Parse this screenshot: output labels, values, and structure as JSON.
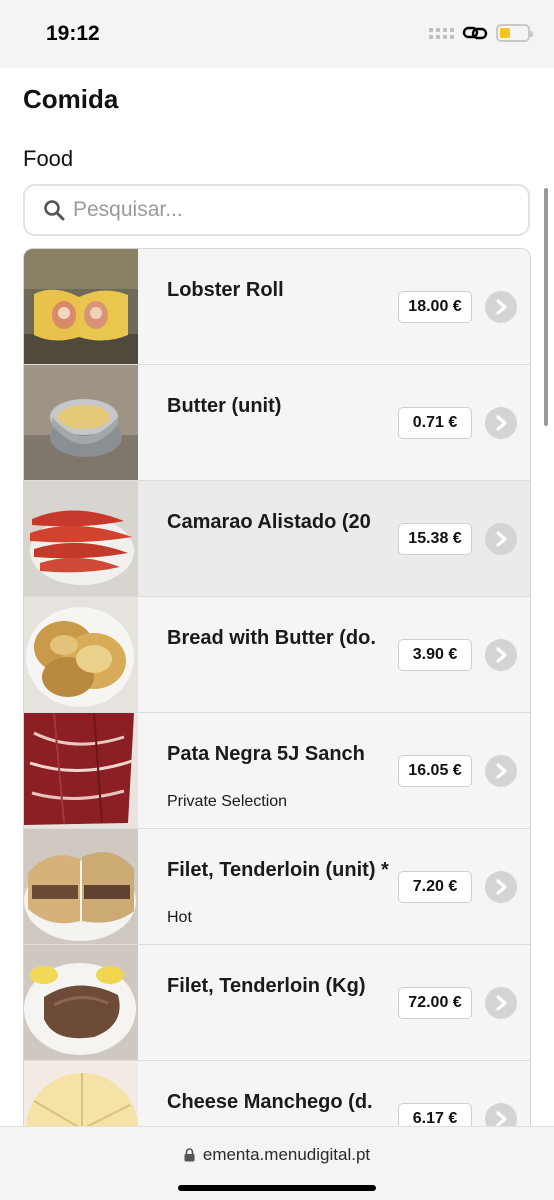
{
  "status_bar": {
    "time": "19:12",
    "battery_level": 0.4
  },
  "header": {
    "title": "Comida",
    "category": "Food"
  },
  "search": {
    "placeholder": "Pesquisar...",
    "value": ""
  },
  "items": [
    {
      "name": "Lobster Roll",
      "subtitle": "",
      "price": "18.00 €",
      "photo": "lobster-roll-photo"
    },
    {
      "name": "Butter (unit)",
      "subtitle": "",
      "price": "0.71 €",
      "photo": "butter-bowl-photo"
    },
    {
      "name": "Camarao Alistado (20",
      "subtitle": "",
      "price": "15.38 €",
      "photo": "shrimp-plate-photo"
    },
    {
      "name": "Bread with Butter (do.",
      "subtitle": "",
      "price": "3.90 €",
      "photo": "bread-plate-photo"
    },
    {
      "name": "Pata Negra 5J Sanch",
      "subtitle": "Private Selection",
      "price": "16.05 €",
      "photo": "ham-slices-photo"
    },
    {
      "name": "Filet, Tenderloin (unit) *",
      "subtitle": "Hot",
      "price": "7.20 €",
      "photo": "filet-sandwich-photo"
    },
    {
      "name": "Filet, Tenderloin (Kg)",
      "subtitle": "",
      "price": "72.00 €",
      "photo": "steak-plate-photo"
    },
    {
      "name": "Cheese Manchego (d.",
      "subtitle": "",
      "price": "6.17 €",
      "photo": "cheese-wheel-photo"
    }
  ],
  "footer": {
    "url": "ementa.menudigital.pt"
  },
  "colors": {
    "background": "#ffffff",
    "row": "#f5f5f5",
    "row_highlight": "#ebebeb",
    "arrow": "#d4d4d4",
    "battery": "#f5c518"
  }
}
